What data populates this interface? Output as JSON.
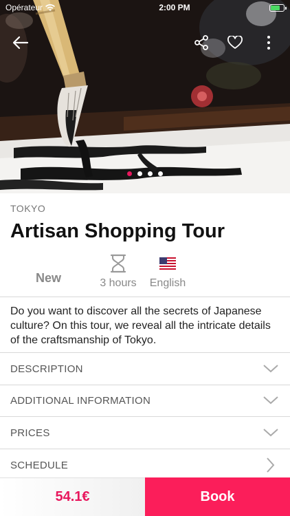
{
  "status_bar": {
    "carrier": "Opérateur",
    "time": "2:00 PM"
  },
  "hero": {
    "image_description_icon": "calligraphy-brush-photo",
    "carousel_pages": 4,
    "carousel_active_index": 0
  },
  "tour": {
    "city": "TOKYO",
    "title": "Artisan Shopping Tour",
    "badge": "New",
    "duration": "3 hours",
    "language": "English",
    "description": "Do you want to discover all the secrets of Japanese culture? On this tour, we reveal all the intricate details of the craftsmanship of Tokyo."
  },
  "sections": [
    {
      "label": "DESCRIPTION",
      "icon": "chevron-down-icon"
    },
    {
      "label": "ADDITIONAL INFORMATION",
      "icon": "chevron-down-icon"
    },
    {
      "label": "PRICES",
      "icon": "chevron-down-icon"
    },
    {
      "label": "SCHEDULE",
      "icon": "chevron-right-icon"
    }
  ],
  "booking": {
    "price": "54.1€",
    "book_label": "Book"
  },
  "colors": {
    "accent": "#fb1e5a",
    "price_text": "#e8175d"
  }
}
